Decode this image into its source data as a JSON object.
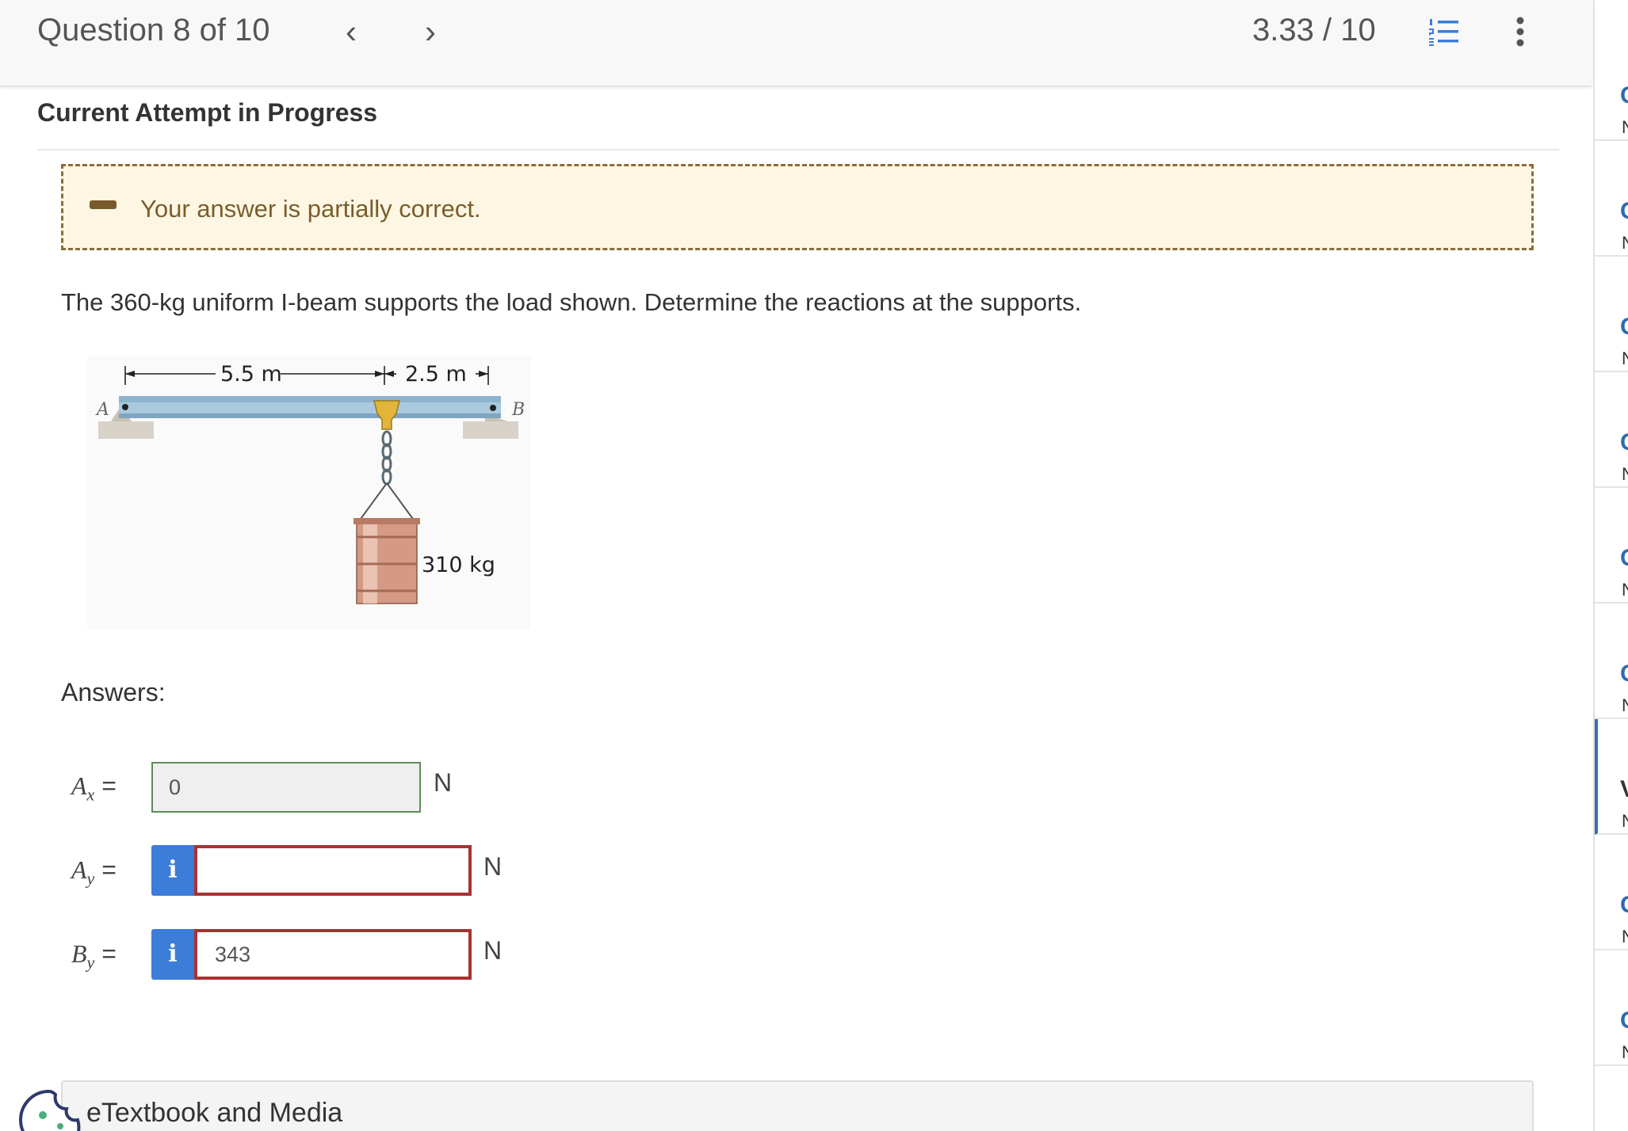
{
  "header": {
    "question_label": "Question 8 of 10",
    "prev_icon": "chevron-left-icon",
    "next_icon": "chevron-right-icon",
    "prev_glyph": "‹",
    "next_glyph": "›",
    "score": "3.33 / 10",
    "list_icon": "numbered-list-icon",
    "more_icon": "more-vertical-icon"
  },
  "attempt_heading": "Current Attempt in Progress",
  "feedback": {
    "status": "partially-correct",
    "message": "Your answer is partially correct."
  },
  "question": {
    "prompt": "The 360-kg uniform I-beam supports the load shown. Determine the reactions at the supports.",
    "figure": {
      "dim_left": "5.5 m",
      "dim_right": "2.5 m",
      "label_a": "A",
      "label_b": "B",
      "load": "310 kg"
    }
  },
  "answers": {
    "heading": "Answers:",
    "rows": [
      {
        "var_main": "A",
        "var_sub": "x",
        "eq": " =",
        "value": "0",
        "unit": "N",
        "state": "correct"
      },
      {
        "var_main": "A",
        "var_sub": "y",
        "eq": " =",
        "value": "",
        "unit": "N",
        "state": "incorrect",
        "info": "i"
      },
      {
        "var_main": "B",
        "var_sub": "y",
        "eq": " =",
        "value": "343",
        "unit": "N",
        "state": "incorrect",
        "info": "i"
      }
    ]
  },
  "etextbook": {
    "label": "eTextbook and Media"
  },
  "sidebar": {
    "items": [
      {
        "c": "C",
        "n": "N"
      },
      {
        "c": "C",
        "n": "N"
      },
      {
        "c": "C",
        "n": "N"
      },
      {
        "c": "C",
        "n": "N"
      },
      {
        "c": "C",
        "n": "N"
      },
      {
        "c": "C",
        "n": "N"
      },
      {
        "c": "V",
        "n": "N",
        "active": true
      },
      {
        "c": "C",
        "n": "N"
      },
      {
        "c": "C",
        "n": "N"
      }
    ]
  },
  "colors": {
    "feedback_bg": "#fdf6e3",
    "feedback_border": "#8a6d3b",
    "correct_border": "#5e8b5a",
    "incorrect_border": "#a83232",
    "info_button": "#3b7dd8",
    "link": "#2b6cb0"
  }
}
